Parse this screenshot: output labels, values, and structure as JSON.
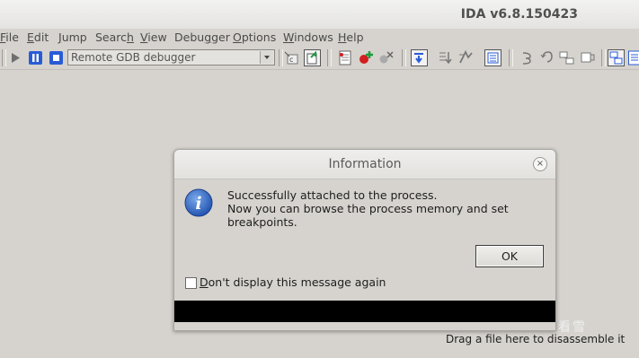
{
  "window": {
    "title": "IDA v6.8.150423"
  },
  "menu": [
    {
      "id": "file",
      "label": "File",
      "mnemonic": "F"
    },
    {
      "id": "edit",
      "label": "Edit",
      "mnemonic": "E"
    },
    {
      "id": "jump",
      "label": "Jump",
      "mnemonic": "J"
    },
    {
      "id": "search",
      "label": "Search",
      "mnemonic": "h"
    },
    {
      "id": "view",
      "label": "View",
      "mnemonic": "V"
    },
    {
      "id": "debugger",
      "label": "Debugger",
      "mnemonic": "g"
    },
    {
      "id": "options",
      "label": "Options",
      "mnemonic": "O"
    },
    {
      "id": "windows",
      "label": "Windows",
      "mnemonic": "W"
    },
    {
      "id": "help",
      "label": "Help",
      "mnemonic": "H"
    }
  ],
  "toolbar": {
    "debugger_select": {
      "value": "Remote GDB debugger"
    },
    "icons": [
      "play-icon",
      "pause-icon",
      "stop-icon",
      "attach-process-icon",
      "debugger-select-icon",
      "breakpoint-list-icon",
      "add-breakpoint-icon",
      "delete-breakpoint-icon",
      "step-into-icon",
      "step-over-icon",
      "run-until-return-icon",
      "show-ip-icon",
      "trace-icon",
      "step-back-icon",
      "trace-function-icon",
      "stack-trace-icon",
      "graph-icon",
      "text-view-icon",
      "new-window-icon"
    ]
  },
  "dialog": {
    "title": "Information",
    "icon": "info-icon",
    "message_line1": "Successfully attached to the process.",
    "message_line2": "Now you can browse the process memory and set breakpoints.",
    "ok_label": "OK",
    "checkbox_label": "Don't display this message again",
    "checkbox_mnemonic": "D",
    "checkbox_checked": false
  },
  "status": {
    "drop_hint": "Drag a file here to disassemble it"
  },
  "watermark": "看雪"
}
